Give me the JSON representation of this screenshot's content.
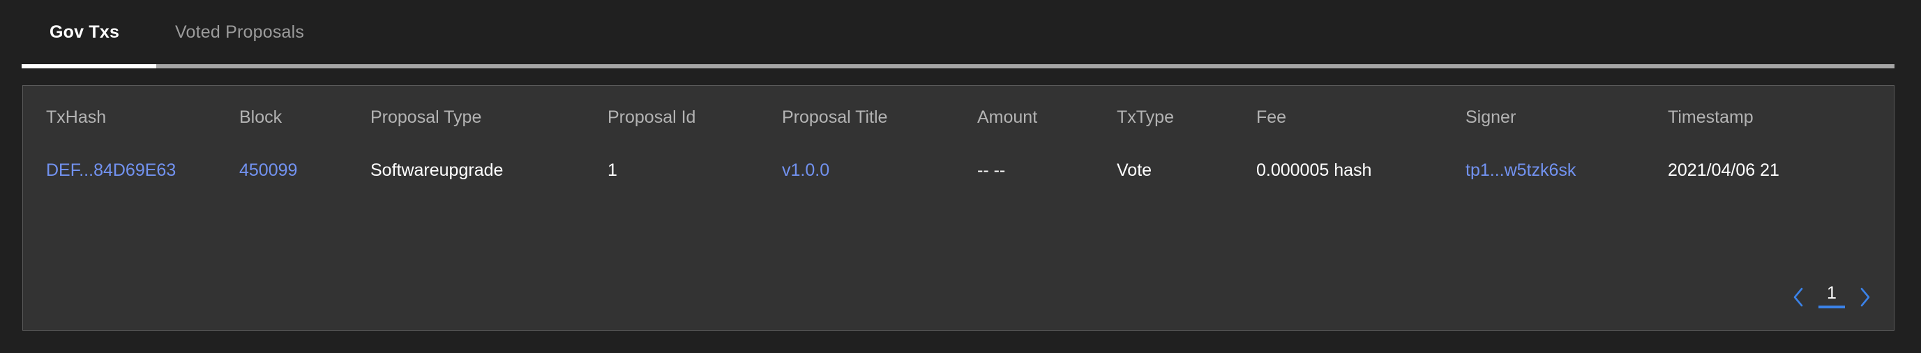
{
  "tabs": [
    {
      "label": "Gov Txs",
      "active": true
    },
    {
      "label": "Voted Proposals",
      "active": false
    }
  ],
  "table": {
    "columns": [
      "TxHash",
      "Block",
      "Proposal Type",
      "Proposal Id",
      "Proposal Title",
      "Amount",
      "TxType",
      "Fee",
      "Signer",
      "Timestamp"
    ],
    "rows": [
      {
        "txhash": "DEF...84D69E63",
        "block": "450099",
        "proposal_type": "Softwareupgrade",
        "proposal_id": "1",
        "proposal_title": "v1.0.0",
        "amount": "-- --",
        "txtype": "Vote",
        "fee": "0.000005 hash",
        "signer": "tp1...w5tzk6sk",
        "timestamp": "2021/04/06 21"
      }
    ]
  },
  "pagination": {
    "prev_icon": "chevron-left-icon",
    "next_icon": "chevron-right-icon",
    "current_page": "1"
  },
  "colors": {
    "page_background": "#202020",
    "card_background": "#333333",
    "card_border": "#5a5a5a",
    "link_blue": "#7292f0",
    "accent_blue": "#3b82e8",
    "header_text": "#b3b3b3",
    "active_tab_text": "#ffffff",
    "inactive_tab_text": "#9b9b9b",
    "tab_track": "#a6a6a6"
  }
}
